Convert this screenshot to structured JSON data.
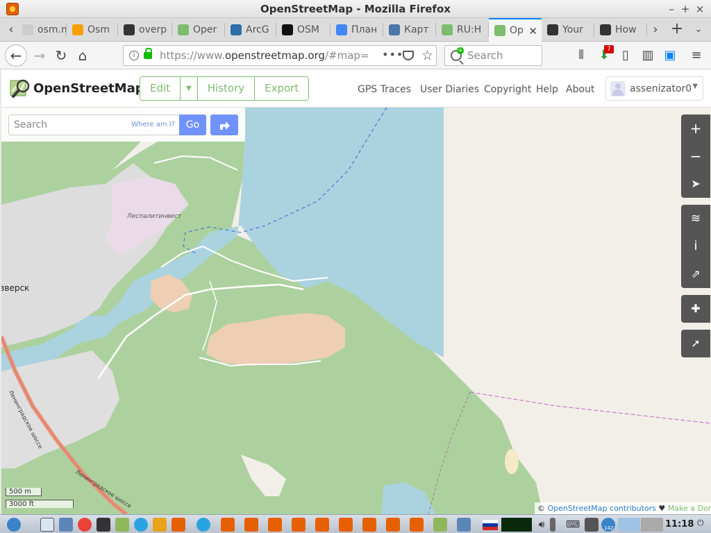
{
  "window": {
    "title": "OpenStreetMap - Mozilla Firefox",
    "minimize": "–",
    "maximize": "+",
    "close": "×"
  },
  "tabs": [
    {
      "label": "osm.ma",
      "color": "#cccccc"
    },
    {
      "label": "Osm",
      "color": "#f5a100"
    },
    {
      "label": "overp",
      "color": "#333333"
    },
    {
      "label": "Oper",
      "color": "#7ebc6f"
    },
    {
      "label": "ArcG",
      "color": "#2f6fa5"
    },
    {
      "label": "OSM",
      "color": "#111111"
    },
    {
      "label": "План",
      "color": "#4285f4"
    },
    {
      "label": "Карт",
      "color": "#4a76a8"
    },
    {
      "label": "RU:H",
      "color": "#7ebc6f"
    },
    {
      "label": "Op",
      "color": "#7ebc6f",
      "active": true
    },
    {
      "label": "Your",
      "color": "#333333"
    },
    {
      "label": "How",
      "color": "#333333"
    }
  ],
  "nav": {
    "url_prefix": "https://www.",
    "url_domain": "openstreetmap.org",
    "url_rest": "/#map=",
    "search_placeholder": "Search",
    "downloads_badge": "7"
  },
  "osm": {
    "brand": "OpenStreetMap",
    "edit": "Edit",
    "history": "History",
    "export": "Export",
    "links": [
      "GPS Traces",
      "User Diaries",
      "Copyright",
      "Help",
      "About"
    ],
    "user": "assenizator0"
  },
  "map": {
    "search_placeholder": "Search",
    "where_am_i": "Where am I?",
    "go": "Go",
    "labels": {
      "lesplitinvest": "Леспалитинвест",
      "town": "зверск",
      "road1": "Ленинградское шоссе",
      "road2": "Ленинградское шоссе"
    },
    "scale_metric": "500 m",
    "scale_imperial": "3000 ft",
    "attribution_prefix": "© ",
    "attribution_link": "OpenStreetMap contributors",
    "attribution_heart": " ♥ ",
    "attribution_donate": "Make a Donation"
  },
  "taskbar": {
    "clock": "11:18",
    "badge": "142"
  }
}
